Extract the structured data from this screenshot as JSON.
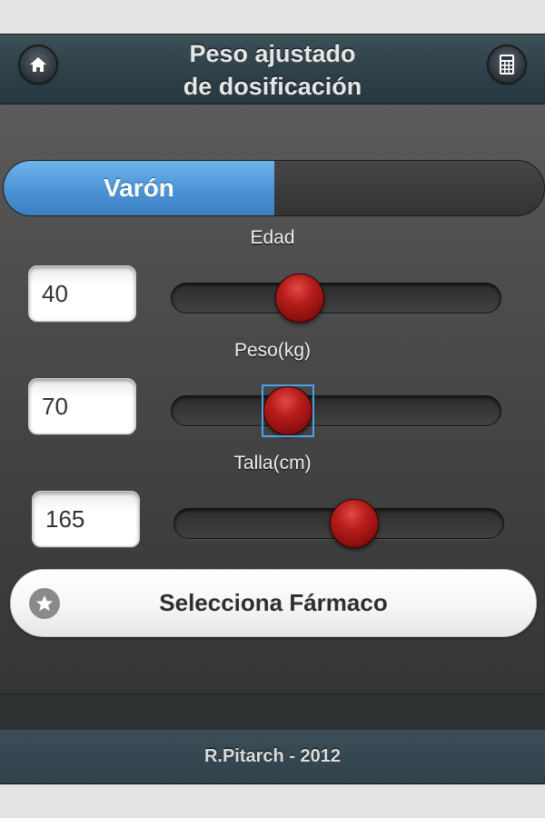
{
  "header": {
    "title_line1": "Peso ajustado",
    "title_line2": "de dosificación",
    "home_icon": "home-icon",
    "calculator_icon": "calculator-icon"
  },
  "gender": {
    "selected_label": "Varón",
    "selected": "on"
  },
  "fields": {
    "edad": {
      "label": "Edad",
      "value": "40",
      "slider_fraction": 0.38
    },
    "peso": {
      "label": "Peso(kg)",
      "value": "70",
      "slider_fraction": 0.34
    },
    "talla": {
      "label": "Talla(cm)",
      "value": "165",
      "slider_fraction": 0.55
    }
  },
  "drug_button": {
    "label": "Selecciona Fármaco",
    "icon": "star-icon"
  },
  "footer": {
    "text": "R.Pitarch - 2012"
  },
  "colors": {
    "accent": "#4b93d5",
    "thumb": "#b81e1c",
    "header": "#2f4049"
  }
}
